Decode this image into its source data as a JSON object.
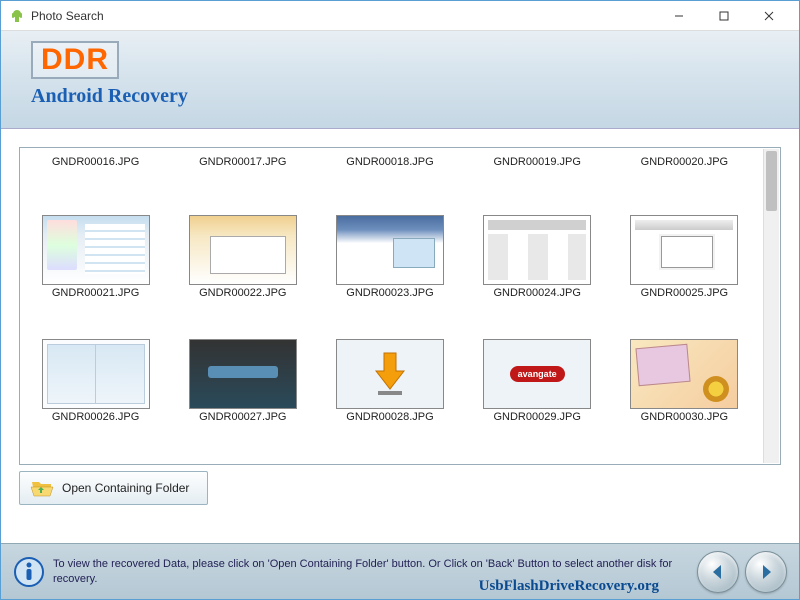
{
  "window": {
    "title": "Photo Search"
  },
  "banner": {
    "brand": "DDR",
    "subtitle": "Android Recovery"
  },
  "files": {
    "row1": [
      "GNDR00016.JPG",
      "GNDR00017.JPG",
      "GNDR00018.JPG",
      "GNDR00019.JPG",
      "GNDR00020.JPG"
    ],
    "row2": [
      "GNDR00021.JPG",
      "GNDR00022.JPG",
      "GNDR00023.JPG",
      "GNDR00024.JPG",
      "GNDR00025.JPG"
    ],
    "row3": [
      "GNDR00026.JPG",
      "GNDR00027.JPG",
      "GNDR00028.JPG",
      "GNDR00029.JPG",
      "GNDR00030.JPG"
    ]
  },
  "avangate_label": "avangate",
  "open_folder_label": "Open Containing Folder",
  "footer": {
    "message": "To view the recovered Data, please click on 'Open Containing Folder' button. Or Click on 'Back' Button to select another disk for recovery.",
    "watermark": "UsbFlashDriveRecovery.org"
  }
}
